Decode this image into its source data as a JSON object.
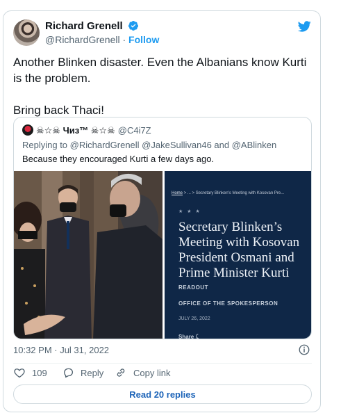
{
  "tweet": {
    "author_name": "Richard Grenell",
    "handle": "@RichardGrenell",
    "separator": " · ",
    "follow_label": "Follow",
    "text": "Another Blinken disaster. Even the Albanians know Kurti is the problem.\n\nBring back Thaci!",
    "timestamp": "10:32 PM · Jul 31, 2022"
  },
  "quoted": {
    "author_name": "☠☆☠ Чиз™ ☠☆☠",
    "handle": "@C4i7Z",
    "reply_prefix": "Replying to ",
    "mentions": "@RichardGrenell @JakeSullivan46 and @ABlinken",
    "text": "Because they encouraged Kurti a few days ago.",
    "photo_right": {
      "crumb_home": "Home",
      "crumb_rest": " >  ...  >  Secretary Blinken's Meeting with Kosovan Pre...",
      "stars": "★ ★ ★",
      "title": "Secretary Blinken’s Meeting with Kosovan President Osmani and Prime Minister Kurti",
      "label_readout": "READOUT",
      "label_office": "OFFICE OF THE SPOKESPERSON",
      "date": "JULY 26, 2022",
      "share": "Share"
    }
  },
  "actions": {
    "like_count": "109",
    "reply_label": "Reply",
    "copy_link_label": "Copy link"
  },
  "read_replies_label": "Read 20 replies",
  "colors": {
    "accent": "#1d9bf0",
    "text": "#0f1419",
    "muted": "#536471",
    "border": "#cfd9de",
    "photo_bg": "#0f2747"
  }
}
